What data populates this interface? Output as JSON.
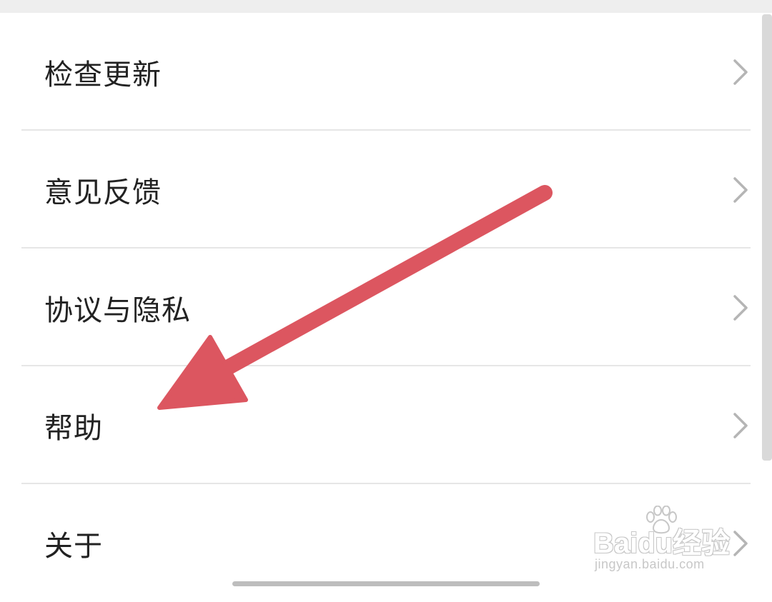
{
  "settings_list": {
    "items": [
      {
        "label": "检查更新"
      },
      {
        "label": "意见反馈"
      },
      {
        "label": "协议与隐私"
      },
      {
        "label": "帮助"
      },
      {
        "label": "关于"
      }
    ]
  },
  "annotation": {
    "arrow_color": "#dc5660"
  },
  "watermark": {
    "logo": "Baidu经验",
    "url": "jingyan.baidu.com"
  },
  "colors": {
    "text": "#222222",
    "divider": "#e6e6e6",
    "chevron": "#b5b5b5"
  }
}
